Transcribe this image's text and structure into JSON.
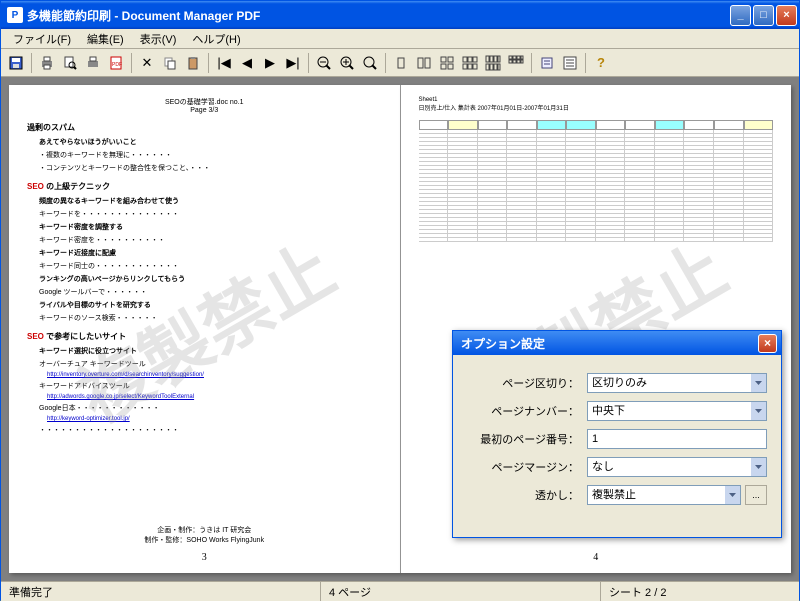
{
  "title": "多機能節約印刷 - Document Manager PDF",
  "menus": {
    "file": "ファイル(F)",
    "edit": "編集(E)",
    "view": "表示(V)",
    "help": "ヘルプ(H)"
  },
  "status": {
    "ready": "準備完了",
    "pages": "4 ページ",
    "sheets": "シート 2 / 2"
  },
  "doc": {
    "header_title": "SEOの基礎学習.doc no.1",
    "header_page": "Page 3/3",
    "s1": "過剰のスパム",
    "s1i1": "あえてやらないほうがいいこと",
    "s2_pre": "SEO",
    "s2": " の上級テクニック",
    "s2i1": "頻度の異なるキーワードを組み合わせて使う",
    "s2i2": "キーワード密度を調整する",
    "s2i3": "キーワード近接度に配慮",
    "s2i4": "ランキングの高いページからリンクしてもらう",
    "s2i5": "ライバルや目標のサイトを研究する",
    "s3_pre": "SEO",
    "s3": " で参考にしたいサイト",
    "s3i1": "キーワード選択に役立つサイト",
    "link1": "http://inventory.overture.com/d/searchinventory/suggestion/",
    "link2": "http://adwords.google.co.jp/select/KeywordToolExternal",
    "link3": "http://keyword-optimizer.tool.jp/",
    "footer1": "企画・制作：うきは IT 研究会",
    "footer2": "制作・監修：SOHO Works FlyingJunk",
    "page_num_left": "3",
    "page_num_right": "4",
    "watermark": "複製禁止"
  },
  "dialog": {
    "title": "オプション設定",
    "labels": {
      "separator": "ページ区切り：",
      "pagenum": "ページナンバー：",
      "firstpage": "最初のページ番号：",
      "margin": "ページマージン：",
      "watermark": "透かし："
    },
    "values": {
      "separator": "区切りのみ",
      "pagenum": "中央下",
      "firstpage": "1",
      "margin": "なし",
      "watermark": "複製禁止"
    },
    "browse": "..."
  }
}
